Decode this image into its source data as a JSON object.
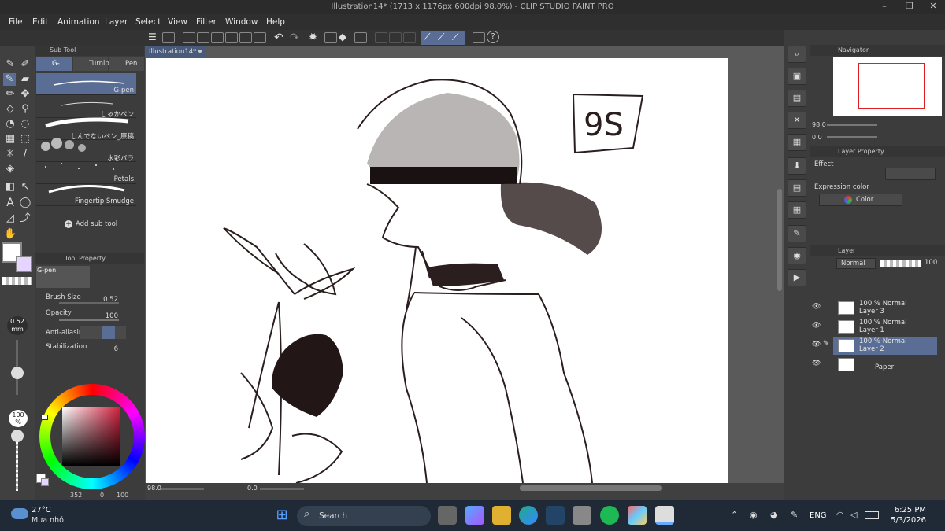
{
  "window": {
    "title": "Illustration14* (1713 x 1176px 600dpi 98.0%) - CLIP STUDIO PAINT PRO"
  },
  "menu": [
    "File",
    "Edit",
    "Animation",
    "Layer",
    "Select",
    "View",
    "Filter",
    "Window",
    "Help"
  ],
  "doc_tab": "Illustration14*",
  "subtool_panel": {
    "title": "Sub Tool",
    "tabs": [
      "G-pen",
      "Turnip",
      "Pen"
    ],
    "items": [
      "G-pen",
      "しゃかペン",
      "しんでないペン_原稿",
      "水彩バラ",
      "Petals",
      "Fingertip Smudge"
    ],
    "add_label": "Add sub tool"
  },
  "tool_property": {
    "title": "Tool Property",
    "brush_name": "G-pen",
    "brush_size_label": "Brush Size",
    "brush_size_value": "0.52",
    "opacity_label": "Opacity",
    "opacity_value": "100",
    "antialias_label": "Anti-aliasing",
    "stabilization_label": "Stabilization",
    "stabilization_value": "6"
  },
  "size_readout": {
    "value": "0.52",
    "unit": "mm"
  },
  "opacity_readout": {
    "value": "100",
    "unit": "%"
  },
  "color_panel": {
    "readout_h": "352",
    "readout_s": "0",
    "readout_v": "100"
  },
  "canvas_status": {
    "zoom": "98.0",
    "angle": "0.0"
  },
  "artwork": {
    "sign": "9S"
  },
  "navigator": {
    "title": "Navigator",
    "zoom": "98.0",
    "angle": "0.0"
  },
  "layer_property": {
    "title": "Layer Property",
    "effect_label": "Effect",
    "expression_label": "Expression color",
    "expression_value": "Color"
  },
  "layer_panel": {
    "title": "Layer",
    "blend": "Normal",
    "opacity": "100",
    "layers": [
      {
        "mode": "100 % Normal",
        "name": "Layer 3",
        "selected": false
      },
      {
        "mode": "100 % Normal",
        "name": "Layer 1",
        "selected": false
      },
      {
        "mode": "100 % Normal",
        "name": "Layer 2",
        "selected": true
      }
    ],
    "paper_label": "Paper"
  },
  "taskbar": {
    "temp": "27°C",
    "weather": "Mưa nhỏ",
    "search_placeholder": "Search",
    "lang": "ENG",
    "time": "6:25 PM",
    "date": "5/3/2026"
  },
  "colors": {
    "accent": "#5a6e95",
    "selected_layer": "#5a6e95",
    "title_bg": "#2b2b2b",
    "taskbar_bg": "#1f2a36"
  }
}
